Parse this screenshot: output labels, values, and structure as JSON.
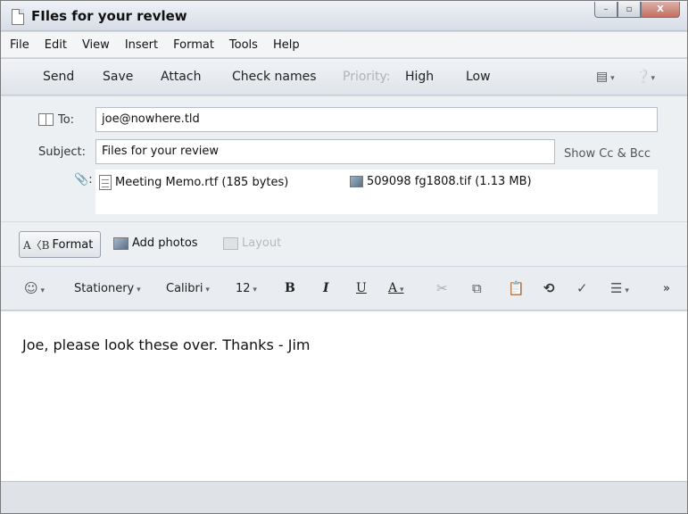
{
  "window": {
    "title": "FIles for your revlew",
    "controls": {
      "minimize": "–",
      "maximize": "▫",
      "close": "X"
    }
  },
  "menu": [
    "File",
    "Edit",
    "View",
    "Insert",
    "Format",
    "Tools",
    "Help"
  ],
  "toolbar": {
    "send": "Send",
    "save": "Save",
    "attach": "Attach",
    "check_names": "Check names",
    "priority": "Priority:",
    "high": "High",
    "low": "Low"
  },
  "header": {
    "to_label": "To:",
    "to_value": "joe@nowhere.tld",
    "subject_label": "Subject:",
    "subject_value": "Files for your review",
    "show_cc_bcc": "Show Cc & Bcc",
    "attachments_label": ":",
    "attachments": [
      {
        "name": "Meeting Memo.rtf (185 bytes)",
        "icon": "document-icon"
      },
      {
        "name": "509098 fg1808.tif (1.13 MB)",
        "icon": "image-icon"
      }
    ]
  },
  "compose_tools": {
    "format": "Format",
    "add_photos": "Add photos",
    "layout": "Layout"
  },
  "format_bar": {
    "stationery": "Stationery",
    "font": "Calibri",
    "size": "12",
    "bold": "B",
    "italic": "I",
    "underline": "U",
    "font_color": "A",
    "more": "»"
  },
  "message_body": "Joe, please look these over. Thanks - Jim"
}
